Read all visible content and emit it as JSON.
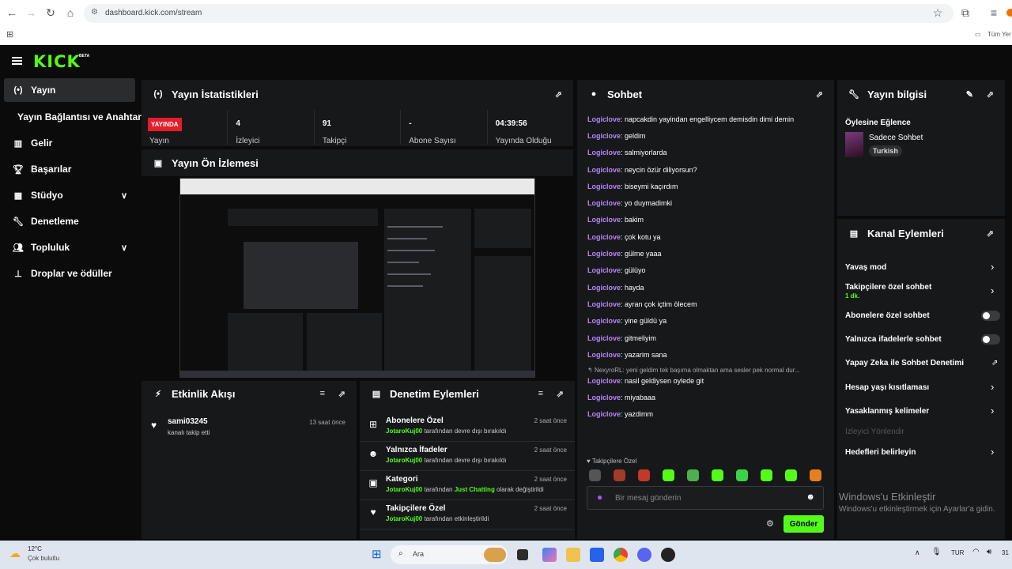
{
  "browser": {
    "url": "dashboard.kick.com/stream",
    "bookmarks_right": "Tüm Yer"
  },
  "app": {
    "logo": "KICK",
    "beta": "BETA"
  },
  "sidebar": {
    "items": [
      {
        "label": "Yayın",
        "icon": "broadcast-icon"
      },
      {
        "label": "Yayın Bağlantısı ve Anahtarı",
        "icon": ""
      },
      {
        "label": "Gelir",
        "icon": "chart-icon"
      },
      {
        "label": "Başarılar",
        "icon": "trophy-icon"
      },
      {
        "label": "Stüdyo",
        "icon": "studio-icon"
      },
      {
        "label": "Denetleme",
        "icon": "wrench-icon"
      },
      {
        "label": "Topluluk",
        "icon": "community-icon"
      },
      {
        "label": "Droplar ve ödüller",
        "icon": "drops-icon"
      }
    ]
  },
  "stats": {
    "title": "Yayın İstatistikleri",
    "live_badge": "YAYINDA",
    "live_label": "Yayın",
    "items": [
      {
        "value": "4",
        "label": "İzleyici"
      },
      {
        "value": "91",
        "label": "Takipçi"
      },
      {
        "value": "-",
        "label": "Abone Sayısı"
      },
      {
        "value": "04:39:56",
        "label": "Yayında Olduğu"
      }
    ]
  },
  "preview": {
    "title": "Yayın Ön İzlemesi"
  },
  "activity": {
    "title": "Etkinlik Akışı",
    "items": [
      {
        "name": "sami03245",
        "desc": "kanalı takip etti",
        "time": "13 saat önce"
      }
    ]
  },
  "moderation": {
    "title": "Denetim Eylemleri",
    "items": [
      {
        "title": "Abonelere Özel",
        "user": "JotaroKuj00",
        "pre": " tarafından devre dışı bırakıldı",
        "extra": "",
        "post": "",
        "time": "2 saat önce"
      },
      {
        "title": "Yalnızca İfadeler",
        "user": "JotaroKuj00",
        "pre": " tarafından devre dışı bırakıldı",
        "extra": "",
        "post": "",
        "time": "2 saat önce"
      },
      {
        "title": "Kategori",
        "user": "JotaroKuj00",
        "pre": " tarafından ",
        "extra": "Just Chatting",
        "post": " olarak değiştirildi",
        "time": "2 saat önce"
      },
      {
        "title": "Takipçilere Özel",
        "user": "JotaroKuj00",
        "pre": " tarafından etkinleştirildi",
        "extra": "",
        "post": "",
        "time": "2 saat önce"
      }
    ]
  },
  "chat": {
    "title": "Sohbet",
    "messages": [
      {
        "user": "Logiclove",
        "text": "napcakdin yayindan engelliycem demisdin dimi demin"
      },
      {
        "user": "Logiclove",
        "text": "geldim"
      },
      {
        "user": "Logiclove",
        "text": "salmiyorlarda"
      },
      {
        "user": "Logiclove",
        "text": "neycin özür diliyorsun?"
      },
      {
        "user": "Logiclove",
        "text": "biseymi kaçırdım"
      },
      {
        "user": "Logiclove",
        "text": "yo duymadimki"
      },
      {
        "user": "Logiclove",
        "text": "bakim"
      },
      {
        "user": "Logiclove",
        "text": "çok kotu ya"
      },
      {
        "user": "Logiclove",
        "text": "gülme yaaa"
      },
      {
        "user": "Logiclove",
        "text": "gülüyo"
      },
      {
        "user": "Logiclove",
        "text": "hayda"
      },
      {
        "user": "Logiclove",
        "text": "ayran çok içtim ölecem"
      },
      {
        "user": "Logiclove",
        "text": "yine güldü ya"
      },
      {
        "user": "Logiclove",
        "text": "gitmeliyim"
      },
      {
        "user": "Logiclove",
        "text": "yazarim sana"
      }
    ],
    "reply_ref": "NexyroRL: yeni geldim tek başıma olmaktan ama sesler pek normal dur...",
    "messages2": [
      {
        "user": "Logiclove",
        "text": "nasil geldiysen oylede git"
      },
      {
        "user": "Logiclove",
        "text": "miyabaaa"
      },
      {
        "user": "Logiclove",
        "text": "yazdimm"
      }
    ],
    "followers_only": "Takipçilere Özel",
    "input_placeholder": "Bir mesaj gönderin",
    "send_label": "Gönder"
  },
  "stream_info": {
    "title": "Yayın bilgisi",
    "stream_title": "Öylesine Eğlence",
    "category": "Sadece Sohbet",
    "language": "Turkish"
  },
  "channel_actions": {
    "title": "Kanal Eylemleri",
    "items": [
      {
        "label": "Yavaş mod",
        "sub": "",
        "control": "chevron"
      },
      {
        "label": "Takipçilere özel sohbet",
        "sub": "1 dk.",
        "control": "chevron"
      },
      {
        "label": "Abonelere özel sohbet",
        "sub": "",
        "control": "toggle"
      },
      {
        "label": "Yalnızca ifadelerle sohbet",
        "sub": "",
        "control": "toggle"
      },
      {
        "label": "Yapay Zeka ile Sohbet Denetimi",
        "sub": "",
        "control": "external"
      },
      {
        "label": "Hesap yaşı kısıtlaması",
        "sub": "",
        "control": "chevron"
      },
      {
        "label": "Yasaklanmış kelimeler",
        "sub": "",
        "control": "chevron"
      },
      {
        "label": "İzleyici Yönlendir",
        "sub": "",
        "control": "none"
      },
      {
        "label": "Hedefleri belirleyin",
        "sub": "",
        "control": "chevron"
      }
    ]
  },
  "windows": {
    "activate_title": "Windows'u Etkinleştir",
    "activate_sub": "Windows'u etkinleştirmek için Ayarlar'a gidin.",
    "weather_temp": "12°C",
    "weather_desc": "Çok bulutlu",
    "search": "Ara",
    "lang": "TUR",
    "clock": "31"
  },
  "colors": {
    "accent": "#53fc18",
    "live": "#e41c2c",
    "chat_user": "#b488f5",
    "panel": "#17181a"
  }
}
